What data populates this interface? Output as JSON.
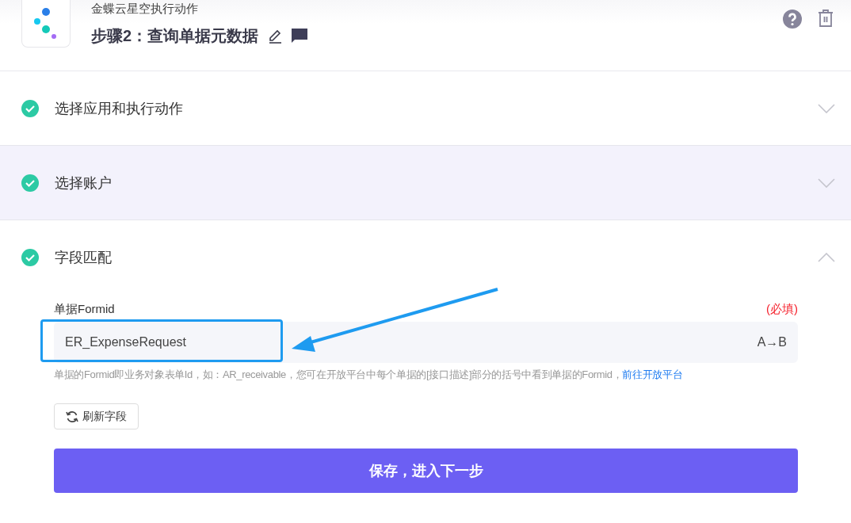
{
  "header": {
    "app_name": "金蝶云星空执行动作",
    "step_title": "步骤2：查询单据元数据"
  },
  "sections": [
    {
      "title": "选择应用和执行动作",
      "completed": true,
      "expanded": false,
      "hovered": false
    },
    {
      "title": "选择账户",
      "completed": true,
      "expanded": false,
      "hovered": true
    },
    {
      "title": "字段匹配",
      "completed": true,
      "expanded": true,
      "hovered": false
    }
  ],
  "field": {
    "label": "单据Formid",
    "required_note": "(必填)",
    "value": "ER_ExpenseRequest",
    "suffix": "A→B",
    "help_text": "单据的Formid即业务对象表单Id，如：AR_receivable，您可在开放平台中每个单据的[接口描述]部分的括号中看到单据的Formid，",
    "help_link": "前往开放平台"
  },
  "refresh_button": "刷新字段",
  "save_button": "保存，进入下一步"
}
